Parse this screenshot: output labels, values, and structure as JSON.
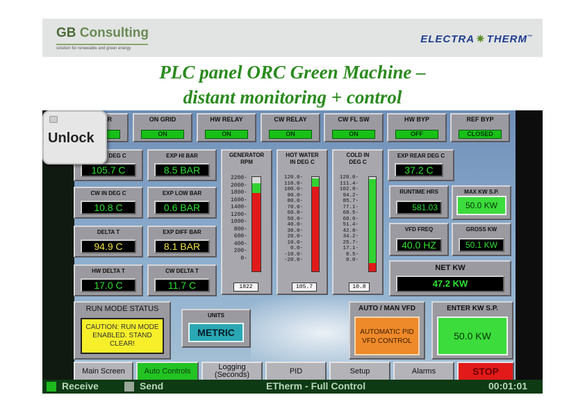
{
  "header": {
    "gb_logo_prefix": "GB",
    "gb_logo_suffix": "Consulting",
    "gb_tagline": "solution for renewable and green energy",
    "et_logo_left": "ELECTRA",
    "et_logo_right": "THERM",
    "et_logo_mark": "™"
  },
  "title": {
    "line1": "PLC  panel ORC Green Machine –",
    "line2": "distant monitoring + control"
  },
  "unlock_label": "Unlock",
  "status_row": [
    {
      "label": "R",
      "value": ""
    },
    {
      "label": "ON GRID",
      "value": "ON"
    },
    {
      "label": "HW RELAY",
      "value": "ON"
    },
    {
      "label": "CW RELAY",
      "value": "ON"
    },
    {
      "label": "CW FL SW",
      "value": "ON"
    },
    {
      "label": "HW BYP",
      "value": "OFF"
    },
    {
      "label": "REF BYP",
      "value": "CLOSED"
    }
  ],
  "readings": {
    "deg_c": {
      "label": "DEG C",
      "value": "105.7 C"
    },
    "exp_hi_bar": {
      "label": "EXP HI BAR",
      "value": "8.5 BAR"
    },
    "cw_in_deg_c": {
      "label": "CW IN DEG C",
      "value": "10.8 C"
    },
    "exp_low_bar": {
      "label": "EXP LOW BAR",
      "value": "0.6 BAR"
    },
    "delta_t": {
      "label": "DELTA T",
      "value": "94.9 C"
    },
    "exp_diff_bar": {
      "label": "EXP DIFF BAR",
      "value": "8.1 BAR"
    },
    "hw_delta_t": {
      "label": "HW DELTA T",
      "value": "17.0 C"
    },
    "cw_delta_t": {
      "label": "CW DELTA T",
      "value": "11.7 C"
    },
    "exp_rear_deg_c": {
      "label": "EXP REAR DEG C",
      "value": "37.2 C"
    },
    "runtime_hrs": {
      "label": "RUNTIME HRS",
      "value": "581.03"
    },
    "max_kw_sp": {
      "label": "MAX KW S.P.",
      "value": "50.0 KW"
    },
    "vfd_freq": {
      "label": "VFD FREQ",
      "value": "40.0 HZ"
    },
    "gross_kw": {
      "label": "GROSS KW",
      "value": "50.1 KW"
    },
    "net_kw": {
      "label": "NET KW",
      "value": "47.2 KW"
    }
  },
  "bars": [
    {
      "title1": "GENERATOR",
      "title2": "RPM",
      "scale": [
        "2200",
        "2000",
        "1800",
        "1600",
        "1400",
        "1200",
        "1000",
        "800",
        "600",
        "400",
        "200",
        "0"
      ],
      "readout": "1822",
      "min": 0,
      "max": 2200,
      "red_value": 1822,
      "green_value": 2050
    },
    {
      "title1": "HOT WATER",
      "title2": "IN DEG C",
      "scale": [
        "120.0",
        "110.0",
        "100.0",
        "90.0",
        "80.0",
        "70.0",
        "60.0",
        "50.0",
        "40.0",
        "30.0",
        "20.0",
        "10.0",
        "0.0",
        "-10.0",
        "-20.0"
      ],
      "readout": "105.7",
      "min": -20,
      "max": 120,
      "red_value": 105.7,
      "green_value": 118
    },
    {
      "title1": "COLD IN",
      "title2": "DEG C",
      "scale": [
        "120.0",
        "111.4",
        "102.8",
        "94.2",
        "85.7",
        "77.1",
        "68.5",
        "60.0",
        "51.4",
        "42.8",
        "34.2",
        "25.7",
        "17.1",
        "8.5",
        "0.0"
      ],
      "readout": "10.8",
      "min": 0,
      "max": 120,
      "red_value": 10.8,
      "green_value": 117
    }
  ],
  "run_mode": {
    "label": "RUN MODE STATUS",
    "message": "CAUTION: RUN MODE ENABLED. STAND CLEAR!"
  },
  "units": {
    "label": "UNITS",
    "value": "METRIC"
  },
  "auto_man": {
    "label": "AUTO / MAN VFD",
    "value": "AUTOMATIC PID VFD CONTROL"
  },
  "enter_kw": {
    "label": "ENTER KW S.P.",
    "value": "50.0 KW"
  },
  "tabs": [
    {
      "label": "Main Screen"
    },
    {
      "label": "Auto Controls"
    },
    {
      "label": "Logging (Seconds)"
    },
    {
      "label": "PID"
    },
    {
      "label": "Setup"
    },
    {
      "label": "Alarms"
    },
    {
      "label": "STOP"
    }
  ],
  "statusbar": {
    "receive": "Receive",
    "send": "Send",
    "center": "ETherm - Full Control",
    "time": "00:01:01"
  },
  "colors": {
    "title_green": "#2a8a1d",
    "indicator_green": "#18c018",
    "digit_green": "#2fe22f",
    "digit_yellow": "#f0e24a",
    "alarm_red": "#e21a1a",
    "caution_yellow": "#f6ef2a",
    "metric_teal": "#29a8b4",
    "pid_orange": "#ef8a2a"
  }
}
